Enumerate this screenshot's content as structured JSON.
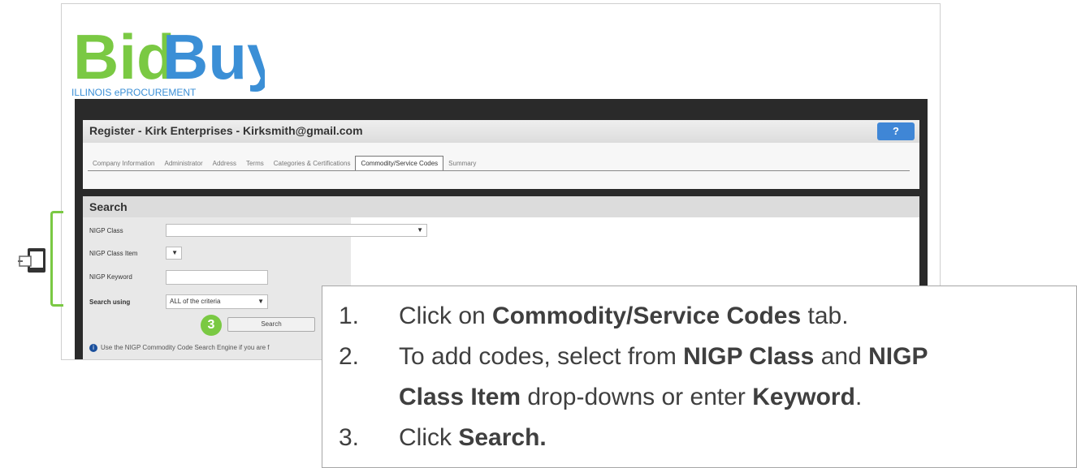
{
  "logo": {
    "text_bid": "Bid",
    "text_buy": "Buy",
    "tagline": "ILLINOIS ePROCUREMENT"
  },
  "register": {
    "title": "Register - Kirk Enterprises - Kirksmith@gmail.com",
    "help_icon": "question-icon",
    "tabs": [
      "Company Information",
      "Administrator",
      "Address",
      "Terms",
      "Categories & Certifications",
      "Commodity/Service Codes",
      "Summary"
    ],
    "active_tab": "Commodity/Service Codes"
  },
  "search": {
    "title": "Search",
    "nigp_class_label": "NIGP Class",
    "nigp_class_item_label": "NIGP Class Item",
    "nigp_keyword_label": "NIGP Keyword",
    "search_using_label": "Search using",
    "search_using_value": "ALL of the criteria",
    "search_button": "Search",
    "step_badge": "3",
    "info_text": "Use the NIGP Commodity Code Search Engine if you are f"
  },
  "colors": {
    "accent_green": "#7ac943",
    "logo_blue": "#3b8fd6",
    "help_blue": "#3f86d6"
  },
  "callout": {
    "s1": {
      "num": "1.",
      "t1": "Click on ",
      "b1": "Commodity/Service Codes",
      "t2": " tab."
    },
    "s2": {
      "num": "2.",
      "t1": "To add codes, select from ",
      "b1": "NIGP Class",
      "t2": " and ",
      "b2": "NIGP"
    },
    "s2b": {
      "b1": "Class Item",
      "t1": " drop-downs or enter ",
      "b2": "Keyword",
      "t2": "."
    },
    "s3": {
      "num": "3.",
      "t1": "Click ",
      "b1": "Search."
    }
  }
}
